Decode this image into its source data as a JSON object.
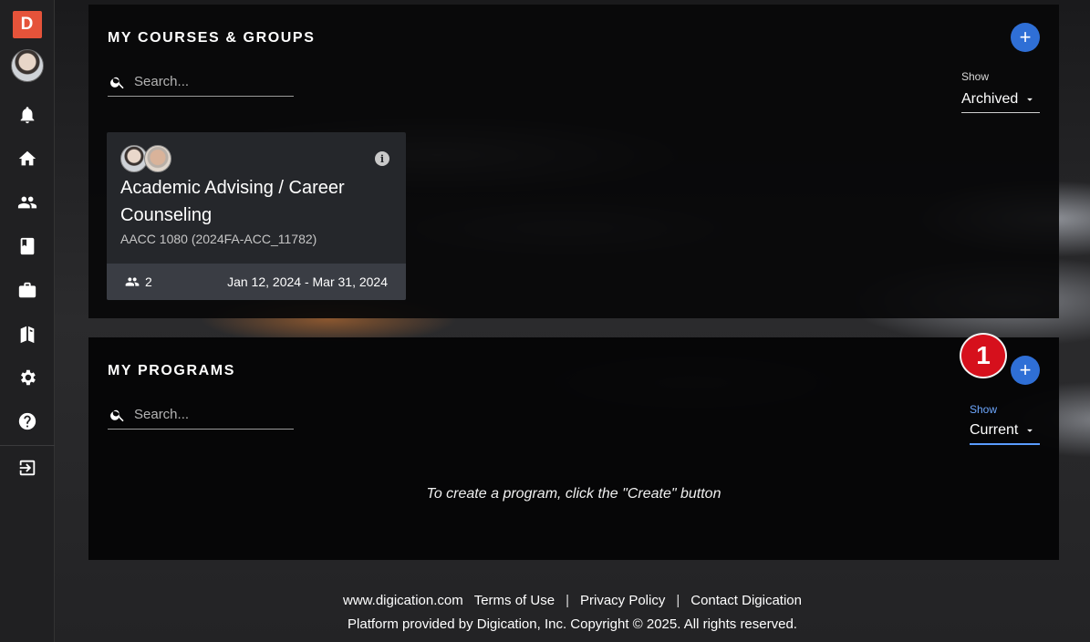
{
  "sidebar": {
    "logo_letter": "D",
    "icons": [
      "bell-icon",
      "home-icon",
      "people-icon",
      "book-icon",
      "briefcase-icon",
      "open-book-icon",
      "gear-icon",
      "help-icon",
      "logout-icon"
    ]
  },
  "courses": {
    "title": "MY COURSES & GROUPS",
    "search_placeholder": "Search...",
    "show_label": "Show",
    "show_value": "Archived",
    "card": {
      "title": "Academic Advising / Career Counseling",
      "code": "AACC 1080 (2024FA-ACC_11782)",
      "member_count": "2",
      "dates": "Jan 12, 2024 - Mar 31, 2024"
    }
  },
  "programs": {
    "title": "MY PROGRAMS",
    "search_placeholder": "Search...",
    "show_label": "Show",
    "show_value": "Current",
    "empty_message": "To create a program, click the \"Create\" button",
    "step_badge": "1"
  },
  "footer": {
    "link1": "www.digication.com",
    "link2": "Terms of Use",
    "link3": "Privacy Policy",
    "link4": "Contact Digication",
    "separator": "|",
    "copyright": "Platform provided by Digication, Inc. Copyright © 2025. All rights reserved."
  },
  "colors": {
    "accent": "#2f6fd6",
    "logo": "#e5533a",
    "badge": "#d6101c"
  }
}
